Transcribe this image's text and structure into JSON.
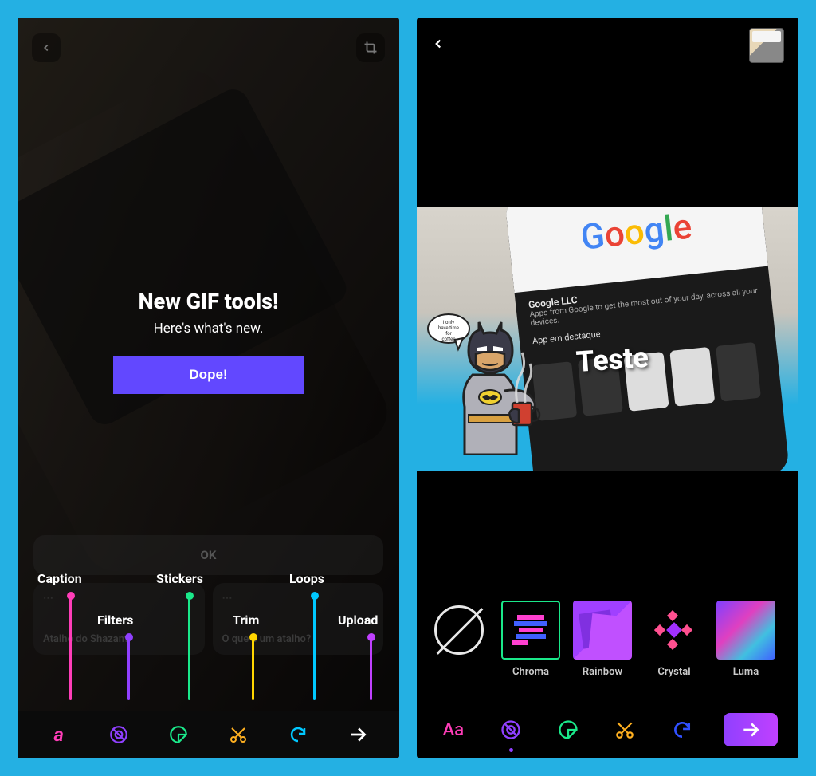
{
  "left": {
    "modal": {
      "title": "New GIF tools!",
      "subtitle": "Here's what's new.",
      "button": "Dope!"
    },
    "ok_label": "OK",
    "cards": [
      {
        "title": "Atalho do Shazam"
      },
      {
        "title": "O que é um atalho?"
      }
    ],
    "labels": {
      "caption": "Caption",
      "filters": "Filters",
      "stickers": "Stickers",
      "trim": "Trim",
      "loops": "Loops",
      "upload": "Upload"
    },
    "colors": {
      "caption": "#ff3db8",
      "filters": "#9040ff",
      "stickers": "#1ae88a",
      "trim": "#ffd500",
      "loops": "#00c8ff",
      "upload": "#c040ff"
    }
  },
  "right": {
    "caption_text": "Teste",
    "google_llc": "Google LLC",
    "google_sub": "Apps from Google to get the most out of your day, across all your devices.",
    "destaque": "App em destaque",
    "filters": [
      {
        "name": "",
        "id": "none"
      },
      {
        "name": "Chroma",
        "id": "chroma"
      },
      {
        "name": "Rainbow",
        "id": "rainbow"
      },
      {
        "name": "Crystal",
        "id": "crystal"
      },
      {
        "name": "Luma",
        "id": "luma"
      }
    ],
    "bubble": "I only have time for coffee"
  }
}
